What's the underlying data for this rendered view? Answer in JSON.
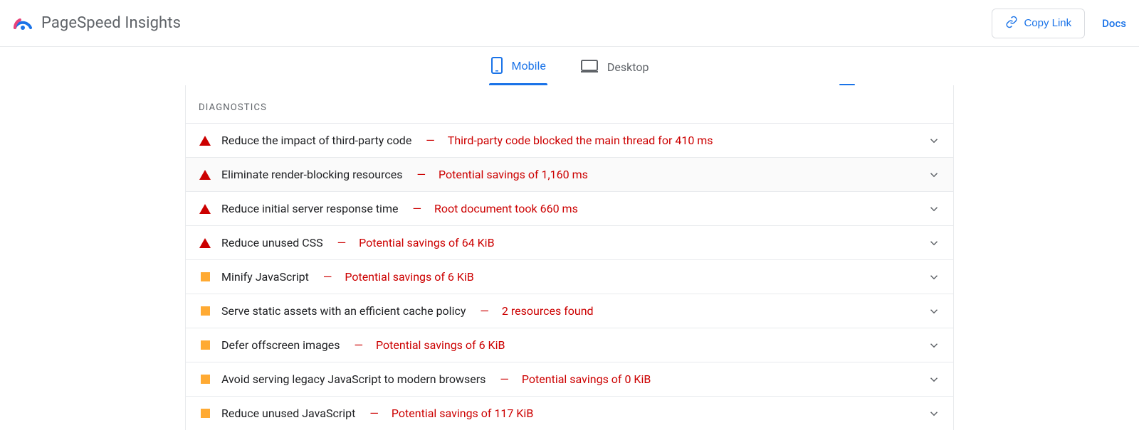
{
  "header": {
    "title": "PageSpeed Insights",
    "copy_label": "Copy Link",
    "docs_label": "Docs"
  },
  "tabs": {
    "mobile": "Mobile",
    "desktop": "Desktop"
  },
  "diagnostics": {
    "heading": "DIAGNOSTICS",
    "items": [
      {
        "severity": "fail",
        "title": "Reduce the impact of third-party code",
        "detail": "Third-party code blocked the main thread for 410 ms",
        "highlight": false
      },
      {
        "severity": "fail",
        "title": "Eliminate render-blocking resources",
        "detail": "Potential savings of 1,160 ms",
        "highlight": true
      },
      {
        "severity": "fail",
        "title": "Reduce initial server response time",
        "detail": "Root document took 660 ms",
        "highlight": false
      },
      {
        "severity": "fail",
        "title": "Reduce unused CSS",
        "detail": "Potential savings of 64 KiB",
        "highlight": false
      },
      {
        "severity": "warn",
        "title": "Minify JavaScript",
        "detail": "Potential savings of 6 KiB",
        "highlight": false
      },
      {
        "severity": "warn",
        "title": "Serve static assets with an efficient cache policy",
        "detail": "2 resources found",
        "highlight": false
      },
      {
        "severity": "warn",
        "title": "Defer offscreen images",
        "detail": "Potential savings of 6 KiB",
        "highlight": false
      },
      {
        "severity": "warn",
        "title": "Avoid serving legacy JavaScript to modern browsers",
        "detail": "Potential savings of 0 KiB",
        "highlight": false
      },
      {
        "severity": "warn",
        "title": "Reduce unused JavaScript",
        "detail": "Potential savings of 117 KiB",
        "highlight": false
      }
    ]
  }
}
